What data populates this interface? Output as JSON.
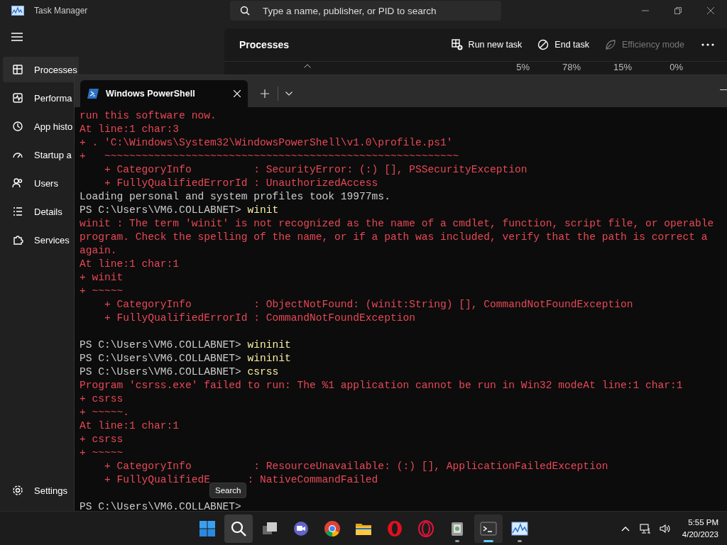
{
  "task_manager": {
    "title": "Task Manager",
    "search": {
      "placeholder": "Type a name, publisher, or PID to search"
    },
    "sidebar": {
      "items": [
        {
          "label": "Processes",
          "selected": true
        },
        {
          "label": "Performa",
          "selected": false
        },
        {
          "label": "App histo",
          "selected": false
        },
        {
          "label": "Startup a",
          "selected": false
        },
        {
          "label": "Users",
          "selected": false
        },
        {
          "label": "Details",
          "selected": false
        },
        {
          "label": "Services",
          "selected": false
        }
      ],
      "settings": {
        "label": "Settings"
      }
    },
    "page_title": "Processes",
    "toolbar": [
      {
        "label": "Run new task",
        "disabled": false
      },
      {
        "label": "End task",
        "disabled": false
      },
      {
        "label": "Efficiency mode",
        "disabled": true
      }
    ],
    "column_values": [
      "5%",
      "78%",
      "15%",
      "0%"
    ]
  },
  "terminal": {
    "tabs": [
      {
        "title": "Windows PowerShell",
        "selected": true
      }
    ],
    "lines": [
      {
        "kind": "error",
        "text": "run this software now."
      },
      {
        "kind": "error",
        "text": "At line:1 char:3"
      },
      {
        "kind": "error",
        "text": "+ . 'C:\\Windows\\System32\\WindowsPowerShell\\v1.0\\profile.ps1'"
      },
      {
        "kind": "error",
        "text": "+   ~~~~~~~~~~~~~~~~~~~~~~~~~~~~~~~~~~~~~~~~~~~~~~~~~~~~~~~~~"
      },
      {
        "kind": "error",
        "text": "    + CategoryInfo          : SecurityError: (:) [], PSSecurityException"
      },
      {
        "kind": "error",
        "text": "    + FullyQualifiedErrorId : UnauthorizedAccess"
      },
      {
        "kind": "output",
        "text": "Loading personal and system profiles took 19977ms."
      },
      {
        "kind": "prompt",
        "prompt": "PS C:\\Users\\VM6.COLLABNET>",
        "command": "winit"
      },
      {
        "kind": "error",
        "text": "winit : The term 'winit' is not recognized as the name of a cmdlet, function, script file, or operable"
      },
      {
        "kind": "error",
        "text": "program. Check the spelling of the name, or if a path was included, verify that the path is correct a"
      },
      {
        "kind": "error",
        "text": "again."
      },
      {
        "kind": "error",
        "text": "At line:1 char:1"
      },
      {
        "kind": "error",
        "text": "+ winit"
      },
      {
        "kind": "error",
        "text": "+ ~~~~~"
      },
      {
        "kind": "error",
        "text": "    + CategoryInfo          : ObjectNotFound: (winit:String) [], CommandNotFoundException"
      },
      {
        "kind": "error",
        "text": "    + FullyQualifiedErrorId : CommandNotFoundException"
      },
      {
        "kind": "blank"
      },
      {
        "kind": "prompt",
        "prompt": "PS C:\\Users\\VM6.COLLABNET>",
        "command": "wininit"
      },
      {
        "kind": "prompt",
        "prompt": "PS C:\\Users\\VM6.COLLABNET>",
        "command": "wininit"
      },
      {
        "kind": "prompt",
        "prompt": "PS C:\\Users\\VM6.COLLABNET>",
        "command": "csrss"
      },
      {
        "kind": "error",
        "text": "Program 'csrss.exe' failed to run: The %1 application cannot be run in Win32 modeAt line:1 char:1"
      },
      {
        "kind": "error",
        "text": "+ csrss"
      },
      {
        "kind": "error",
        "text": "+ ~~~~~."
      },
      {
        "kind": "error",
        "text": "At line:1 char:1"
      },
      {
        "kind": "error",
        "text": "+ csrss"
      },
      {
        "kind": "error",
        "text": "+ ~~~~~"
      },
      {
        "kind": "error",
        "text": "    + CategoryInfo          : ResourceUnavailable: (:) [], ApplicationFailedException"
      },
      {
        "kind": "split",
        "text": "    + FullyQualifiedE",
        "text_after": ": NativeCommandFailed"
      },
      {
        "kind": "blank"
      },
      {
        "kind": "prompt",
        "prompt": "PS C:\\Users\\VM6.COLLABNET>"
      }
    ]
  },
  "tooltip": {
    "label": "Search"
  },
  "taskbar": {
    "apps": [
      {
        "running": false,
        "active": false,
        "hovered": false
      },
      {
        "running": false,
        "active": false,
        "hovered": true
      },
      {
        "running": false,
        "active": false,
        "hovered": false
      },
      {
        "running": false,
        "active": false,
        "hovered": false
      },
      {
        "running": false,
        "active": false,
        "hovered": false
      },
      {
        "running": false,
        "active": false,
        "hovered": false
      },
      {
        "running": false,
        "active": false,
        "hovered": false
      },
      {
        "running": false,
        "active": false,
        "hovered": false
      },
      {
        "running": true,
        "active": false,
        "hovered": false
      },
      {
        "running": true,
        "active": true,
        "hovered": false
      },
      {
        "running": true,
        "active": false,
        "hovered": false
      }
    ],
    "clock": {
      "time": "5:55 PM",
      "date": "4/20/2023"
    }
  }
}
